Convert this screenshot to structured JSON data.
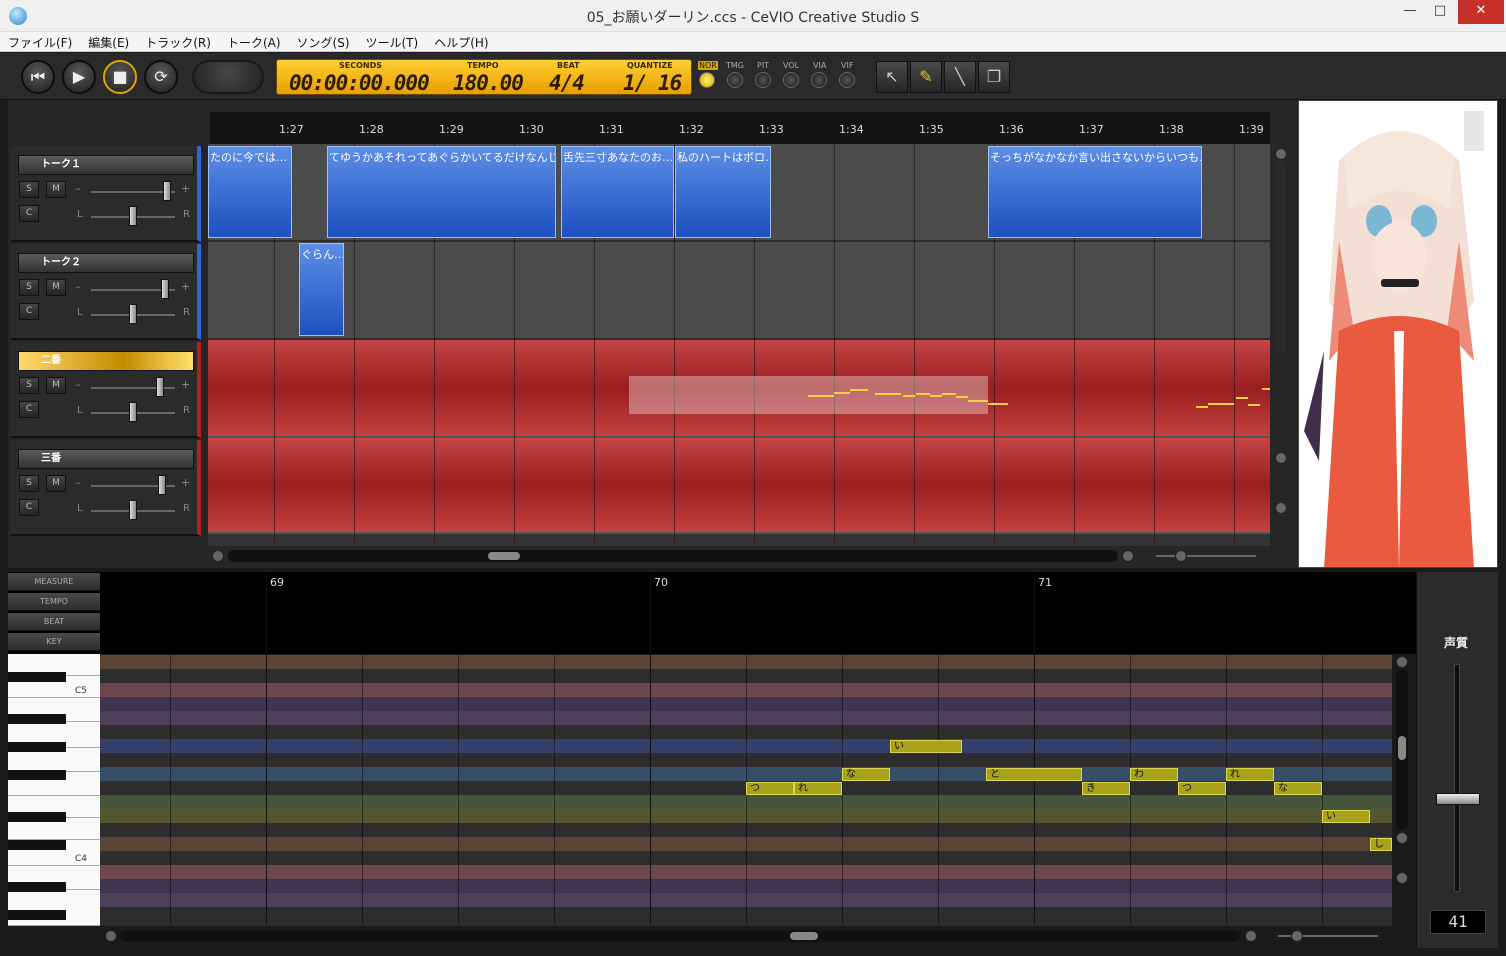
{
  "window": {
    "title": "05_お願いダーリン.ccs - CeVIO Creative Studio S",
    "minimize": "—",
    "maximize": "□",
    "close": "✕"
  },
  "menu": [
    "ファイル(F)",
    "編集(E)",
    "トラック(R)",
    "トーク(A)",
    "ソング(S)",
    "ツール(T)",
    "ヘルプ(H)"
  ],
  "transport": {
    "rewind": "⏮",
    "play": "▶",
    "stop": "■",
    "loop": "⟳"
  },
  "lcd": {
    "seconds_label": "SECONDS",
    "seconds": "00:00:00.000",
    "tempo_label": "TEMPO",
    "tempo": "180.00",
    "beat_label": "BEAT",
    "beat": "4/4",
    "quantize_label": "QUANTIZE",
    "quantize": "1/ 16"
  },
  "params": [
    "NOR",
    "TMG",
    "PIT",
    "VOL",
    "VIA",
    "VIF"
  ],
  "tools": {
    "select": "↖",
    "pencil": "✎",
    "line": "╲",
    "window": "❐"
  },
  "ruler": [
    "1:27",
    "1:28",
    "1:29",
    "1:30",
    "1:31",
    "1:32",
    "1:33",
    "1:34",
    "1:35",
    "1:36",
    "1:37",
    "1:38",
    "1:39"
  ],
  "tracks": [
    {
      "name": "トーク１",
      "type": "talk",
      "solo": "S",
      "mute": "M",
      "c": "C",
      "l": "L",
      "r": "R",
      "minus": "–",
      "plus": "+"
    },
    {
      "name": "トーク２",
      "type": "talk",
      "solo": "S",
      "mute": "M",
      "c": "C",
      "l": "L",
      "r": "R",
      "minus": "–",
      "plus": "+"
    },
    {
      "name": "二番",
      "type": "song",
      "solo": "S",
      "mute": "M",
      "c": "C",
      "l": "L",
      "r": "R",
      "minus": "–",
      "plus": "+"
    },
    {
      "name": "三番",
      "type": "song",
      "solo": "S",
      "mute": "M",
      "c": "C",
      "l": "L",
      "r": "R",
      "minus": "–",
      "plus": "+"
    }
  ],
  "clips": {
    "talk1": [
      "たのに今では…",
      "てゆうかあそれってあぐらかいてるだけなんじゃな…",
      "舌先三寸あなたのお…",
      "私のハートはボロ…",
      "そっちがなかなか言い出さないからいつも…"
    ],
    "talk2": [
      "ぐらん…"
    ]
  },
  "piano": {
    "labels": [
      "MEASURE",
      "TEMPO",
      "BEAT",
      "KEY"
    ],
    "measures": [
      "69",
      "70",
      "71"
    ],
    "keys": {
      "c5": "C5",
      "c4": "C4"
    },
    "notes": [
      "い",
      "な",
      "と",
      "わ",
      "れ",
      "つ",
      "れ",
      "き",
      "つ",
      "な",
      "い",
      "し"
    ]
  },
  "voice": {
    "label": "声質",
    "value": "41"
  },
  "colors": {
    "talk_clip": "#2a5fd0",
    "song_lane": "#a52628",
    "note": "#a8a21c",
    "lcd": "#ffc21a"
  }
}
